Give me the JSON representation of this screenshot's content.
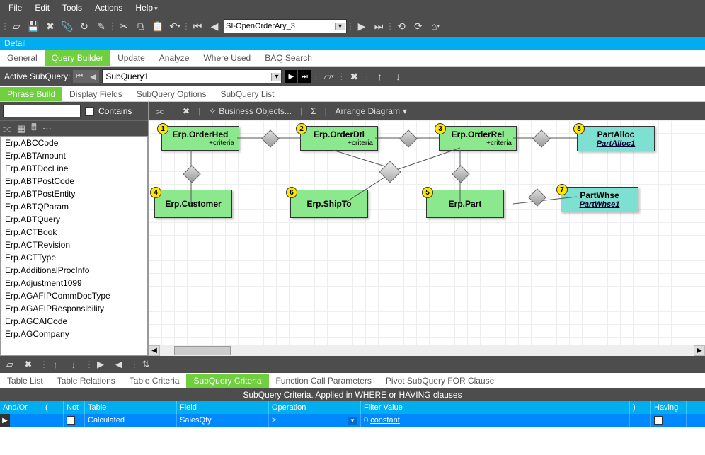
{
  "menubar": {
    "file": "File",
    "edit": "Edit",
    "tools": "Tools",
    "actions": "Actions",
    "help": "Help"
  },
  "toolbar": {
    "query_name": "SI-OpenOrderAry_3"
  },
  "detailbar": {
    "label": "Detail"
  },
  "tabs": {
    "general": "General",
    "querybuilder": "Query Builder",
    "update": "Update",
    "analyze": "Analyze",
    "whereused": "Where Used",
    "baqsearch": "BAQ Search"
  },
  "subquery": {
    "label": "Active SubQuery:",
    "value": "SubQuery1"
  },
  "phrasetabs": {
    "phrasebuild": "Phrase Build",
    "displayfields": "Display Fields",
    "subqueryoptions": "SubQuery Options",
    "subquerylist": "SubQuery List"
  },
  "search": {
    "contains": "Contains"
  },
  "tables": [
    "Erp.ABCCode",
    "Erp.ABTAmount",
    "Erp.ABTDocLine",
    "Erp.ABTPostCode",
    "Erp.ABTPostEntity",
    "Erp.ABTQParam",
    "Erp.ABTQuery",
    "Erp.ACTBook",
    "Erp.ACTRevision",
    "Erp.ACTType",
    "Erp.AdditionalProcInfo",
    "Erp.Adjustment1099",
    "Erp.AGAFIPCommDocType",
    "Erp.AGAFIPResponsibility",
    "Erp.AGCAICode",
    "Erp.AGCompany"
  ],
  "canvastoolbar": {
    "bizobj": "Business Objects...",
    "arrange": "Arrange Diagram"
  },
  "nodes": {
    "orderhed": {
      "title": "Erp.OrderHed",
      "crit": "+criteria"
    },
    "orderdtl": {
      "title": "Erp.OrderDtl",
      "crit": "+criteria"
    },
    "orderrel": {
      "title": "Erp.OrderRel",
      "crit": "+criteria"
    },
    "customer": {
      "title": "Erp.Customer"
    },
    "shipto": {
      "title": "Erp.ShipTo"
    },
    "part": {
      "title": "Erp.Part"
    },
    "partalloc": {
      "title": "PartAlloc",
      "sub": "PartAlloc1"
    },
    "partwhse": {
      "title": "PartWhse",
      "sub": "PartWhse1"
    }
  },
  "bottomtabs": {
    "tablelist": "Table List",
    "tablerelations": "Table Relations",
    "tablecriteria": "Table Criteria",
    "subquerycriteria": "SubQuery Criteria",
    "functioncall": "Function Call Parameters",
    "pivot": "Pivot SubQuery FOR Clause"
  },
  "criteria": {
    "header_label": "SubQuery Criteria. Applied in WHERE or HAVING clauses",
    "cols": {
      "andor": "And/Or",
      "p1": "(",
      "not": "Not",
      "table": "Table",
      "field": "Field",
      "operation": "Operation",
      "filter": "Filter Value",
      "p2": ")",
      "having": "Having"
    },
    "row": {
      "table": "Calculated",
      "field": "SalesQty",
      "operation": ">",
      "constant_prefix": "0",
      "constant_label": "constant"
    }
  }
}
